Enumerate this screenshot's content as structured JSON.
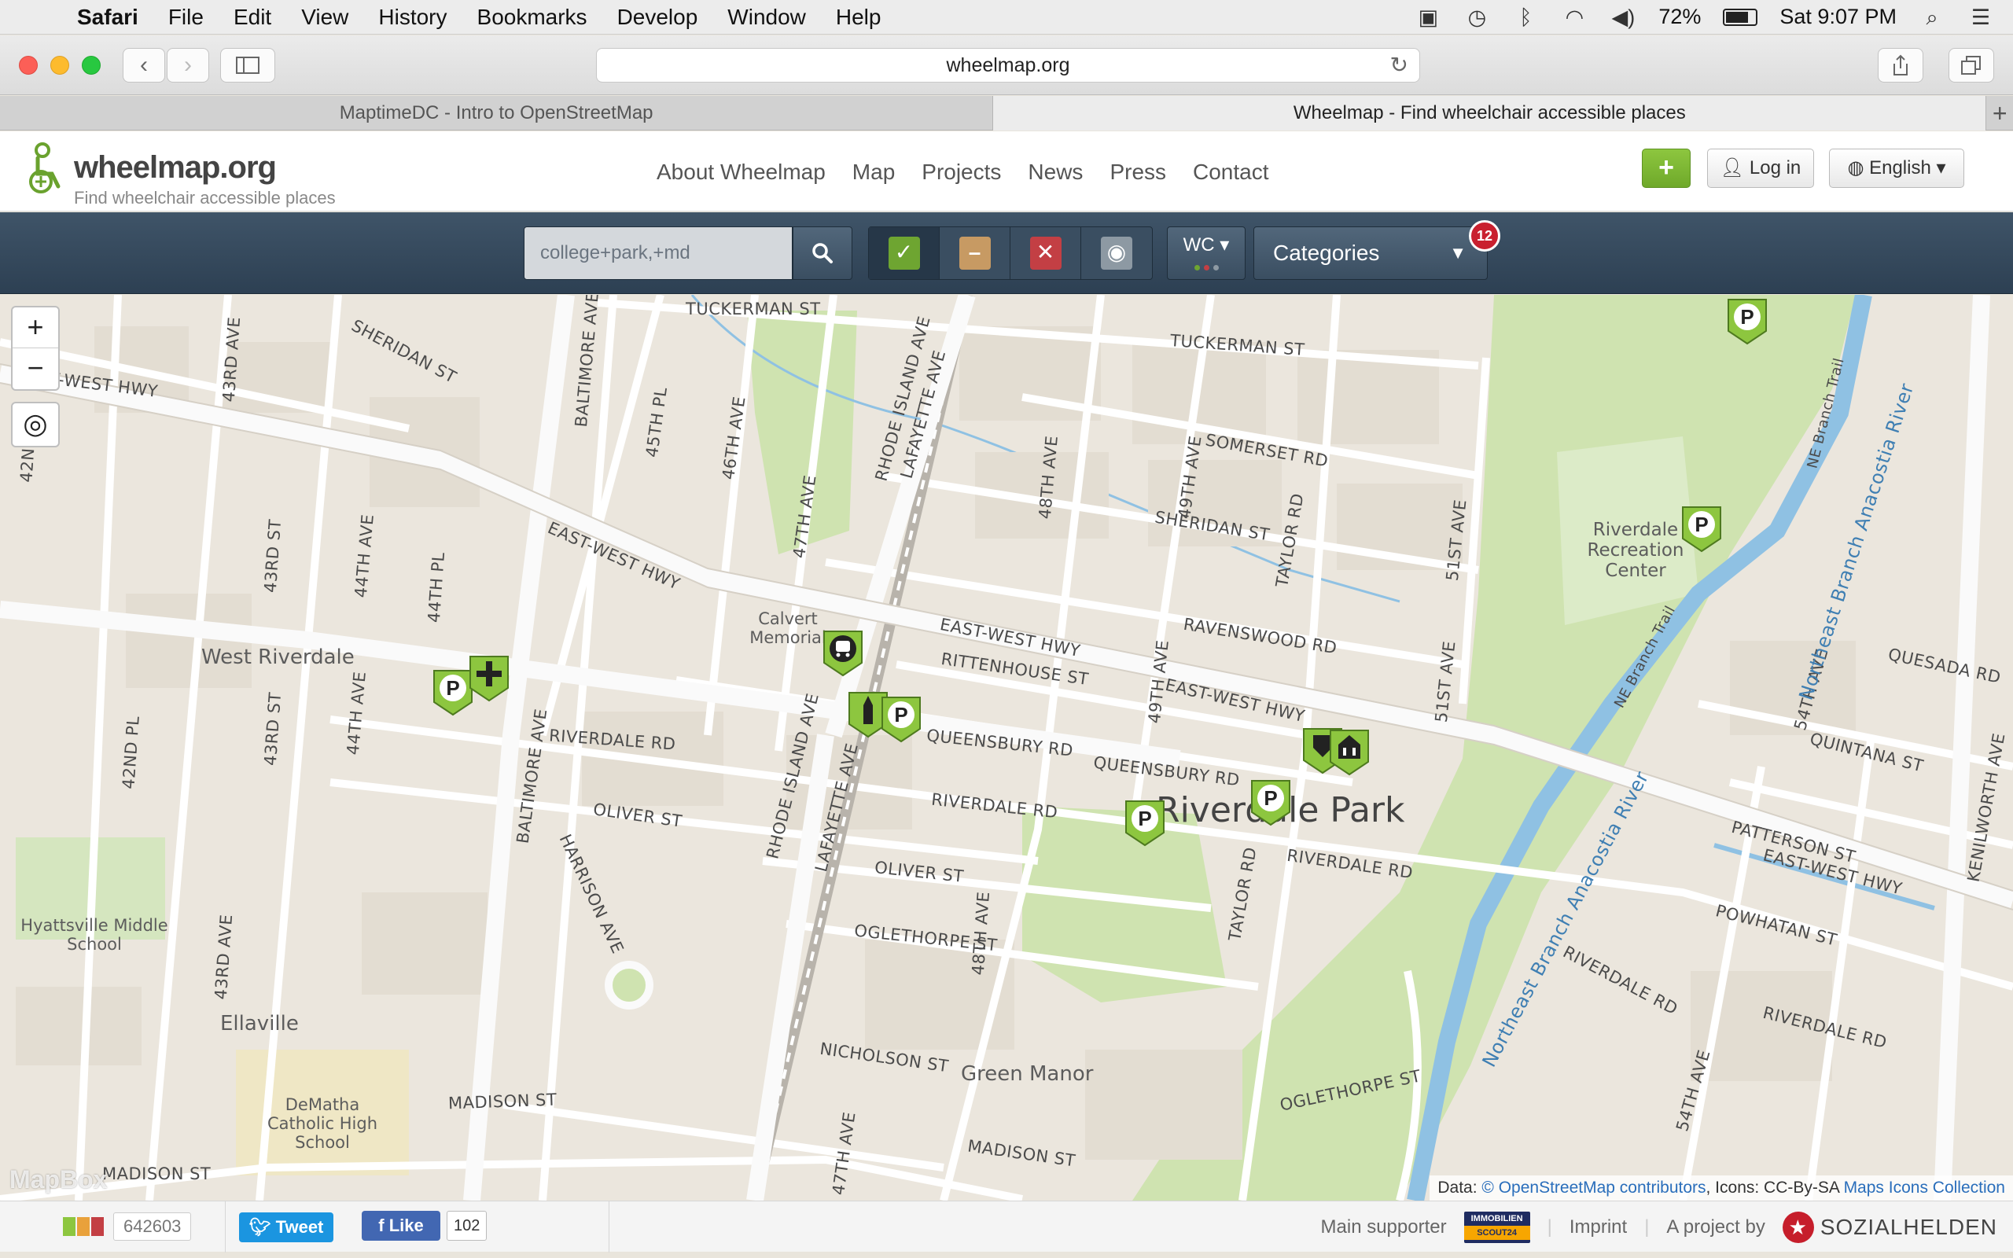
{
  "menubar": {
    "app": "Safari",
    "items": [
      "File",
      "Edit",
      "View",
      "History",
      "Bookmarks",
      "Develop",
      "Window",
      "Help"
    ],
    "battery": "72%",
    "clock": "Sat 9:07 PM"
  },
  "browser": {
    "url": "wheelmap.org",
    "tabs": [
      {
        "title": "MaptimeDC - Intro to OpenStreetMap"
      },
      {
        "title": "Wheelmap - Find wheelchair accessible places"
      }
    ]
  },
  "site": {
    "logo_text": "wheelmap.org",
    "tagline": "Find wheelchair accessible places",
    "nav": [
      "About Wheelmap",
      "Map",
      "Projects",
      "News",
      "Press",
      "Contact"
    ],
    "add_label": "+",
    "login_label": "Log in",
    "language_label": "English"
  },
  "filters": {
    "search_value": "college+park,+md",
    "status_colors": {
      "yes": "#6ea531",
      "limited": "#c79a63",
      "no": "#c33f44",
      "unknown": "#8d99a3"
    },
    "wc_label": "WC",
    "categories_label": "Categories",
    "categories_count": "12"
  },
  "map": {
    "zoom_in": "+",
    "zoom_out": "−",
    "places": [
      "West Riverdale",
      "Ellaville",
      "Green Manor",
      "Riverdale Park"
    ],
    "pois": [
      "Hyattsville Middle School",
      "DeMatha Catholic High School",
      "Riverdale Recreation Center",
      "Calvert Memorial"
    ],
    "streets": [
      "TUCKERMAN ST",
      "SHERIDAN ST",
      "EAST-WEST HWY",
      "SOMERSET RD",
      "RAVENSWOOD RD",
      "RITTENHOUSE ST",
      "QUEENSBURY RD",
      "RIVERDALE RD",
      "OLIVER ST",
      "OGLETHORPE ST",
      "NICHOLSON ST",
      "MADISON ST",
      "BALTIMORE AVE",
      "RHODE ISLAND AVE",
      "LAFAYETTE AVE",
      "HARRISON AVE",
      "TAYLOR RD",
      "48TH AVE",
      "49TH AVE",
      "51ST AVE",
      "47TH AVE",
      "46TH AVE",
      "45TH PL",
      "44TH AVE",
      "43RD ST",
      "42ND PL",
      "43RD AVE",
      "44TH PL",
      "QUINTANA ST",
      "QUESADA RD",
      "PATTERSON ST",
      "POWHATAN ST",
      "54TH AVE",
      "KENILWORTH AVE",
      "NE Branch Trail",
      "Northeast Branch Anacostia River"
    ],
    "attribution_prefix": "Data: ",
    "attribution_osm": "© OpenStreetMap contributors",
    "attribution_icons": ", Icons: CC-By-SA ",
    "attribution_maps": "Maps Icons Collection",
    "mapbox": "MapBox"
  },
  "footer": {
    "counter": "642603",
    "tweet": "Tweet",
    "like": "Like",
    "like_count": "102",
    "supporter": "Main supporter",
    "supporter_logo_top": "IMMOBILIEN",
    "supporter_logo_bottom": "SCOUT24",
    "imprint": "Imprint",
    "project_by": "A project by",
    "org": "SOZIALHELDEN"
  }
}
